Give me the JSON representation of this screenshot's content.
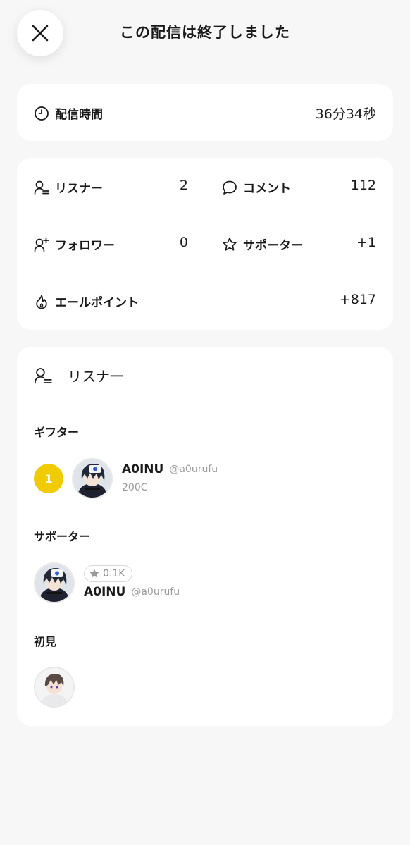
{
  "header": {
    "title": "この配信は終了しました",
    "close_icon": "close-icon"
  },
  "duration": {
    "icon": "clock-icon",
    "label": "配信時間",
    "value": "36分34秒"
  },
  "stats": {
    "listeners": {
      "icon": "listener-icon",
      "label": "リスナー",
      "value": "2"
    },
    "comments": {
      "icon": "comment-icon",
      "label": "コメント",
      "value": "112"
    },
    "followers": {
      "icon": "follower-icon",
      "label": "フォロワー",
      "value": "0"
    },
    "supporters": {
      "icon": "star-icon",
      "label": "サポーター",
      "value": "+1"
    },
    "yell_points": {
      "icon": "flame-icon",
      "label": "エールポイント",
      "value": "+817"
    }
  },
  "listener_panel": {
    "icon": "listener-icon",
    "title": "リスナー",
    "gifters": {
      "title": "ギフター",
      "items": [
        {
          "rank": "1",
          "name": "A0INU",
          "handle": "@a0urufu",
          "coins": "200C"
        }
      ]
    },
    "supporters": {
      "title": "サポーター",
      "items": [
        {
          "badge": "0.1K",
          "name": "A0INU",
          "handle": "@a0urufu"
        }
      ]
    },
    "first_timers": {
      "title": "初見"
    }
  },
  "colors": {
    "background": "#f7f7f7",
    "card": "#ffffff",
    "rank_gold": "#f0cb00",
    "muted_text": "#9a9a9a"
  }
}
